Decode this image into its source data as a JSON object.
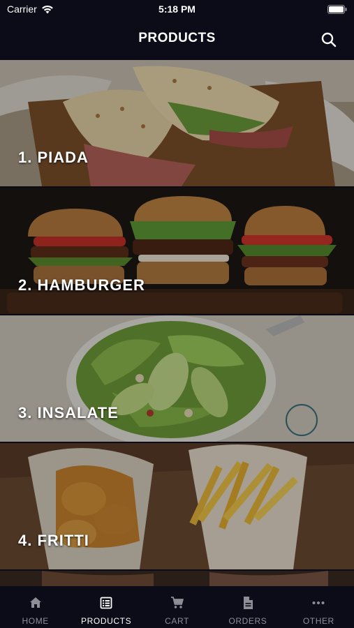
{
  "status": {
    "carrier": "Carrier",
    "time": "5:18 PM"
  },
  "header": {
    "title": "PRODUCTS"
  },
  "products": [
    {
      "label": "1.  PIADA"
    },
    {
      "label": "2.  HAMBURGER"
    },
    {
      "label": "3.  INSALATE"
    },
    {
      "label": "4.  FRITTI"
    }
  ],
  "tabs": [
    {
      "label": "HOME",
      "icon": "home-icon"
    },
    {
      "label": "PRODUCTS",
      "icon": "list-icon",
      "active": true
    },
    {
      "label": "CART",
      "icon": "cart-icon"
    },
    {
      "label": "ORDERS",
      "icon": "document-icon"
    },
    {
      "label": "OTHER",
      "icon": "more-icon"
    }
  ],
  "colors": {
    "bar_background": "#0b0c17",
    "tab_active": "#ffffff",
    "tab_inactive": "#8d8e96"
  }
}
